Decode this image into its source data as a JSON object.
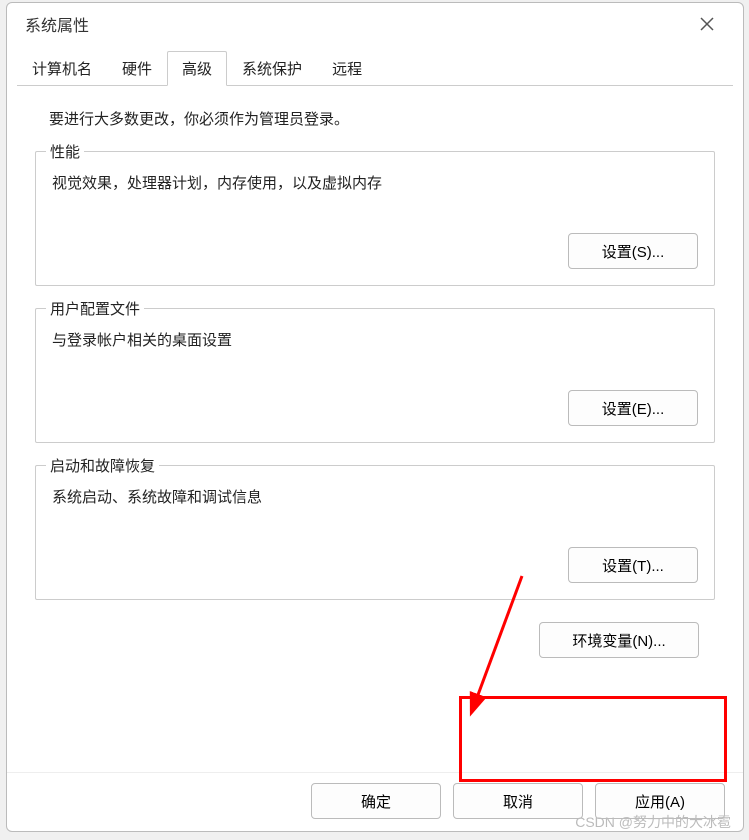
{
  "window": {
    "title": "系统属性"
  },
  "tabs": {
    "t0": "计算机名",
    "t1": "硬件",
    "t2": "高级",
    "t3": "系统保护",
    "t4": "远程",
    "active_index": 2
  },
  "body": {
    "admin_note": "要进行大多数更改，你必须作为管理员登录。",
    "performance": {
      "title": "性能",
      "desc": "视觉效果，处理器计划，内存使用，以及虚拟内存",
      "button": "设置(S)..."
    },
    "user_profiles": {
      "title": "用户配置文件",
      "desc": "与登录帐户相关的桌面设置",
      "button": "设置(E)..."
    },
    "startup_recovery": {
      "title": "启动和故障恢复",
      "desc": "系统启动、系统故障和调试信息",
      "button": "设置(T)..."
    },
    "env_vars_button": "环境变量(N)..."
  },
  "footer": {
    "ok": "确定",
    "cancel": "取消",
    "apply": "应用(A)"
  },
  "watermark": "CSDN @努力中的大冰雹"
}
